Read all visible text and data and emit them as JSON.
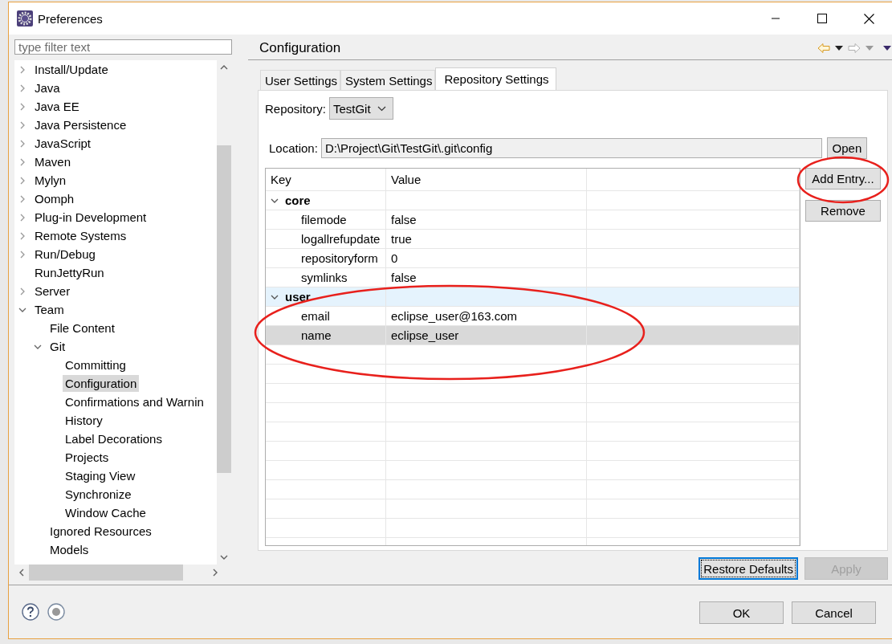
{
  "window": {
    "title": "Preferences"
  },
  "filter": {
    "placeholder": "type filter text"
  },
  "tree": [
    {
      "label": "Install/Update",
      "expanded": false,
      "selected": false
    },
    {
      "label": "Java",
      "expanded": false,
      "selected": false
    },
    {
      "label": "Java EE",
      "expanded": false,
      "selected": false
    },
    {
      "label": "Java Persistence",
      "expanded": false,
      "selected": false
    },
    {
      "label": "JavaScript",
      "expanded": false,
      "selected": false
    },
    {
      "label": "Maven",
      "expanded": false,
      "selected": false
    },
    {
      "label": "Mylyn",
      "expanded": false,
      "selected": false
    },
    {
      "label": "Oomph",
      "expanded": false,
      "selected": false
    },
    {
      "label": "Plug-in Development",
      "expanded": false,
      "selected": false
    },
    {
      "label": "Remote Systems",
      "expanded": false,
      "selected": false
    },
    {
      "label": "Run/Debug",
      "expanded": false,
      "selected": false
    },
    {
      "label": "RunJettyRun",
      "selected": false
    },
    {
      "label": "Server",
      "expanded": false,
      "selected": false
    },
    {
      "label": "Team",
      "expanded": true,
      "selected": false,
      "children": [
        {
          "label": "File Content",
          "selected": false
        },
        {
          "label": "Git",
          "expanded": true,
          "selected": false,
          "children": [
            {
              "label": "Committing",
              "selected": false
            },
            {
              "label": "Configuration",
              "selected": true
            },
            {
              "label": "Confirmations and Warnin",
              "selected": false
            },
            {
              "label": "History",
              "selected": false
            },
            {
              "label": "Label Decorations",
              "selected": false
            },
            {
              "label": "Projects",
              "selected": false
            },
            {
              "label": "Staging View",
              "selected": false
            },
            {
              "label": "Synchronize",
              "selected": false
            },
            {
              "label": "Window Cache",
              "selected": false
            }
          ]
        },
        {
          "label": "Ignored Resources",
          "selected": false
        },
        {
          "label": "Models",
          "selected": false
        }
      ]
    }
  ],
  "page": {
    "title": "Configuration"
  },
  "tabs": [
    {
      "label": "User Settings",
      "selected": false
    },
    {
      "label": "System Settings",
      "selected": false
    },
    {
      "label": "Repository Settings",
      "selected": true
    }
  ],
  "repository": {
    "label": "Repository:",
    "value": "TestGit"
  },
  "location": {
    "label": "Location:",
    "value": "D:\\Project\\Git\\TestGit\\.git\\config",
    "button": "Open"
  },
  "table": {
    "columns": [
      "Key",
      "Value"
    ],
    "groups": [
      {
        "name": "core",
        "expanded": true,
        "hovered": false,
        "entries": [
          {
            "key": "filemode",
            "value": "false",
            "selected": false
          },
          {
            "key": "logallrefupdate",
            "value": "true",
            "selected": false
          },
          {
            "key": "repositoryform",
            "value": "0",
            "selected": false
          },
          {
            "key": "symlinks",
            "value": "false",
            "selected": false
          }
        ]
      },
      {
        "name": "user",
        "expanded": true,
        "hovered": true,
        "entries": [
          {
            "key": "email",
            "value": "eclipse_user@163.com",
            "selected": false
          },
          {
            "key": "name",
            "value": "eclipse_user",
            "selected": true
          }
        ]
      }
    ]
  },
  "side_buttons": [
    "Add Entry...",
    "Remove"
  ],
  "actions": [
    {
      "label": "Restore Defaults",
      "focused": true,
      "disabled": false
    },
    {
      "label": "Apply",
      "focused": false,
      "disabled": true
    }
  ],
  "dialog_buttons": [
    "OK",
    "Cancel"
  ]
}
